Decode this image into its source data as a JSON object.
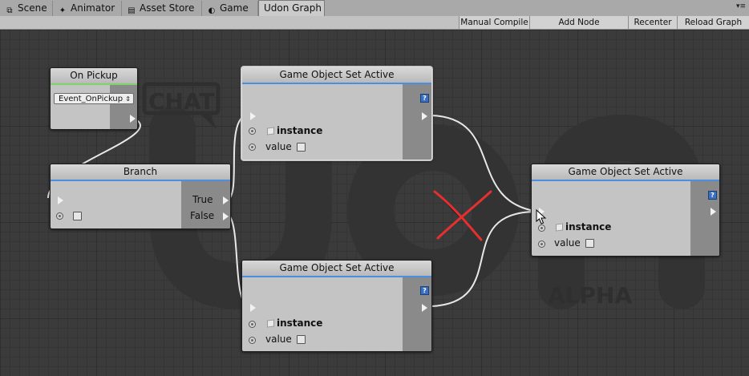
{
  "tabs": [
    {
      "label": "Scene",
      "icon": "scene-icon",
      "glyph": "⧉"
    },
    {
      "label": "Animator",
      "icon": "animator-icon",
      "glyph": "✦"
    },
    {
      "label": "Asset Store",
      "icon": "asset-store-icon",
      "glyph": "▤"
    },
    {
      "label": "Game",
      "icon": "game-icon",
      "glyph": "◐"
    },
    {
      "label": "Udon Graph",
      "icon": "",
      "glyph": ""
    }
  ],
  "toolbar": {
    "manual_compile": "Manual Compile",
    "add_node": "Add Node",
    "recenter": "Recenter",
    "reload_graph": "Reload Graph"
  },
  "watermark": {
    "brand": "CHAT",
    "tag": "ALPHA"
  },
  "nodes": {
    "on_pickup": {
      "title": "On Pickup",
      "dropdown_value": "Event_OnPickup"
    },
    "branch": {
      "title": "Branch",
      "true_label": "True",
      "false_label": "False"
    },
    "set_active_top": {
      "title": "Game Object Set Active",
      "instance_label": "instance",
      "value_label": "value"
    },
    "set_active_bottom": {
      "title": "Game Object Set Active",
      "instance_label": "instance",
      "value_label": "value"
    },
    "set_active_right": {
      "title": "Game Object Set Active",
      "instance_label": "instance",
      "value_label": "value"
    }
  },
  "help_glyph": "?",
  "colors": {
    "flow_header_accent": "#4d8ee0",
    "event_header_accent": "#7ed36b",
    "annotation_x": "#e53030",
    "wire": "#e8e8e8"
  }
}
